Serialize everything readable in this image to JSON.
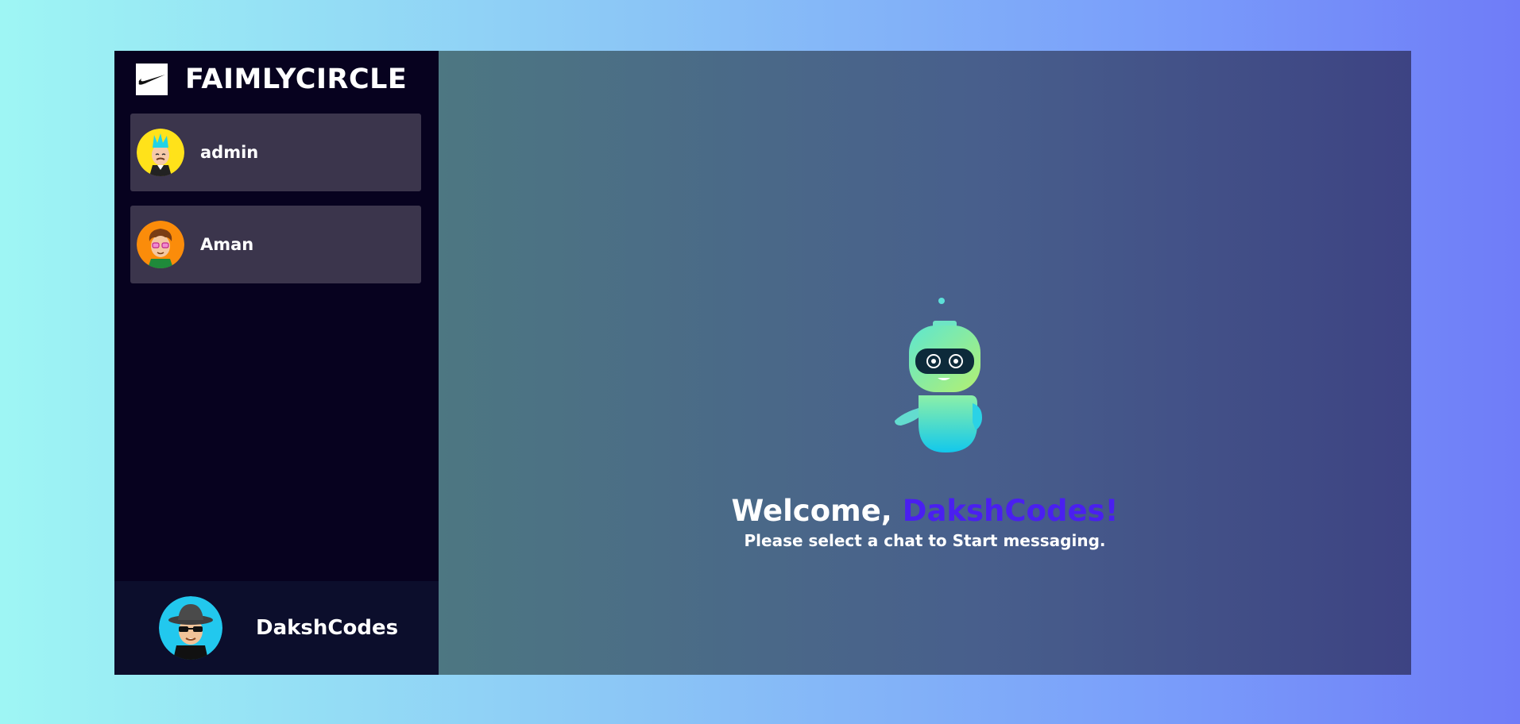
{
  "sidebar": {
    "brand": {
      "name": "FAIMLYCIRCLE",
      "logo_icon": "swoosh-icon"
    },
    "contacts": [
      {
        "name": "admin",
        "avatar": "avatar-blue-hair"
      },
      {
        "name": "Aman",
        "avatar": "avatar-curly-glasses"
      }
    ],
    "current_user": {
      "name": "DakshCodes",
      "avatar": "avatar-hat-sunglasses"
    }
  },
  "main": {
    "welcome_prefix": "Welcome,",
    "welcome_name": "DakshCodes!",
    "subtitle": "Please select a chat to Start messaging.",
    "illustration": "robot-icon"
  },
  "colors": {
    "sidebar_bg": "#07021f",
    "contact_bg": "#3b354c",
    "accent_name": "#4a1ff0"
  }
}
